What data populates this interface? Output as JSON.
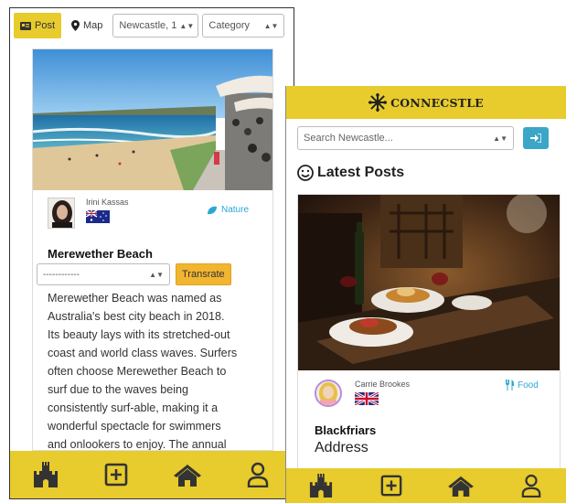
{
  "left_app": {
    "toolbar": {
      "post_tab": "Post",
      "map_tab": "Map",
      "location_select": "Newcastle, 1",
      "category_select": "Category"
    },
    "post": {
      "author": "Irini Kassas",
      "author_flag": "australia-flag",
      "category": "Nature",
      "title": "Merewether Beach",
      "language_select": "------------",
      "translate_button": "Transrate",
      "body_lines": [
        "Merewether Beach was named as",
        "Australia's best city beach in 2018.",
        "Its beauty lays with its stretched-out",
        "coast and world class waves. Surfers",
        "often choose Merewether Beach to",
        "surf due to the waves being",
        "consistently surf-able, making it a",
        "wonderful spectacle for swimmers",
        "and onlookers to enjoy. The annual"
      ]
    },
    "bottom_nav": [
      "castle-icon",
      "add-icon",
      "home-icon",
      "user-icon"
    ]
  },
  "right_app": {
    "brand": "CONNECSTLE",
    "search_placeholder": "Search Newcastle...",
    "section_heading": "Latest Posts",
    "post": {
      "author": "Carrie Brookes",
      "author_flag": "uk-flag",
      "category": "Food",
      "title": "Blackfriars",
      "address_label": "Address"
    },
    "bottom_nav": [
      "castle-icon",
      "add-icon",
      "home-icon",
      "user-icon"
    ]
  },
  "colors": {
    "accent_yellow": "#e8cb2c",
    "translate_orange": "#f2b530",
    "category_blue": "#2aa8d4",
    "login_teal": "#3ba6c6"
  }
}
